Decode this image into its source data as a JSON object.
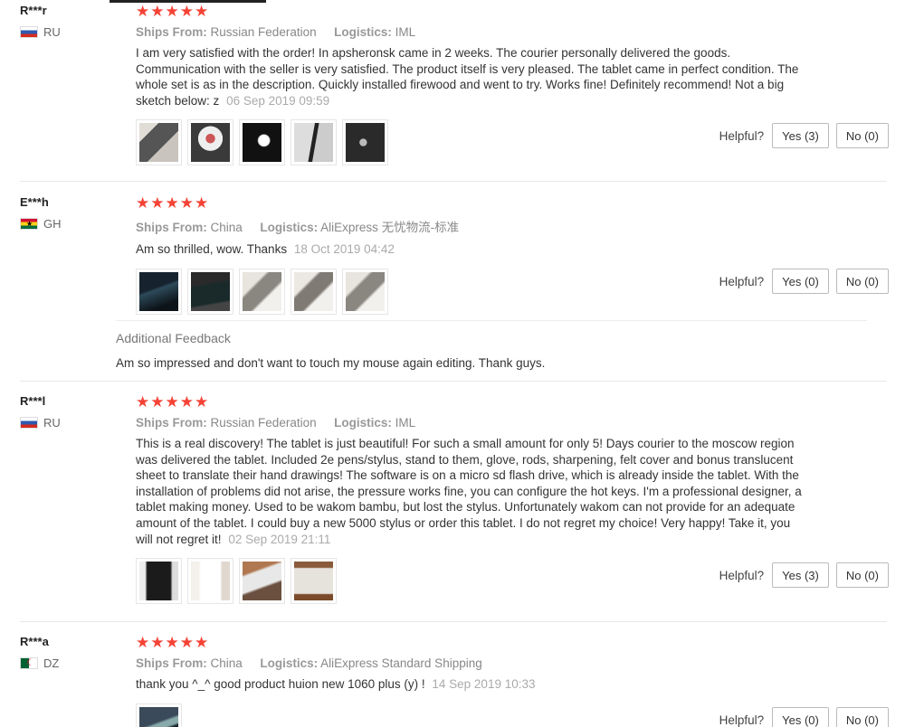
{
  "ui": {
    "ships_from_label": "Ships From:",
    "logistics_label": "Logistics:",
    "helpful_label": "Helpful?",
    "additional_feedback_label": "Additional Feedback",
    "star_color": "#f44336"
  },
  "reviews": [
    {
      "user": "R***r",
      "country": "RU",
      "flag": "russia-flag-icon",
      "rating": 5,
      "stars": "★★★★★",
      "ships_from": "Russian Federation",
      "logistics": "IML",
      "text": "I am very satisfied with the order! In apsheronsk came in 2 weeks. The courier personally delivered the goods. Communication with the seller is very satisfied. The product itself is very pleased. The tablet came in perfect condition. The whole set is as in the description. Quickly installed firewood and went to try. Works fine! Definitely recommend! Not a big sketch below: z",
      "date": "06 Sep 2019 09:59",
      "yes_label": "Yes (3)",
      "no_label": "No (0)"
    },
    {
      "user": "E***h",
      "country": "GH",
      "flag": "ghana-flag-icon",
      "rating": 5,
      "stars": "★★★★★",
      "ships_from": "China",
      "logistics": "AliExpress 无忧物流-标准",
      "text": "Am so thrilled, wow. Thanks",
      "date": "18 Oct 2019 04:42",
      "yes_label": "Yes (0)",
      "no_label": "No (0)",
      "additional_feedback": "Am so impressed and don't want to touch my mouse again editing. Thank guys."
    },
    {
      "user": "R***l",
      "country": "RU",
      "flag": "russia-flag-icon",
      "rating": 5,
      "stars": "★★★★★",
      "ships_from": "Russian Federation",
      "logistics": "IML",
      "text": "This is a real discovery! The tablet is just beautiful! For such a small amount for only 5! Days courier to the moscow region was delivered the tablet. Included 2e pens/stylus, stand to them, glove, rods, sharpening, felt cover and bonus translucent sheet to translate their hand drawings! The software is on a micro sd flash drive, which is already inside the tablet. With the installation of problems did not arise, the pressure works fine, you can configure the hot keys. I'm a professional designer, a tablet making money. Used to be wakom bambu, but lost the stylus. Unfortunately wakom can not provide for an adequate amount of the tablet. I could buy a new 5000 stylus or order this tablet. I do not regret my choice! Very happy! Take it, you will not regret it!",
      "date": "02 Sep 2019 21:11",
      "yes_label": "Yes (3)",
      "no_label": "No (0)"
    },
    {
      "user": "R***a",
      "country": "DZ",
      "flag": "algeria-flag-icon",
      "rating": 5,
      "stars": "★★★★★",
      "ships_from": "China",
      "logistics": "AliExpress Standard Shipping",
      "text": "thank you ^_^ good product huion new 1060 plus (y) !",
      "date": "14 Sep 2019 10:33",
      "yes_label": "Yes (0)",
      "no_label": "No (0)"
    }
  ]
}
